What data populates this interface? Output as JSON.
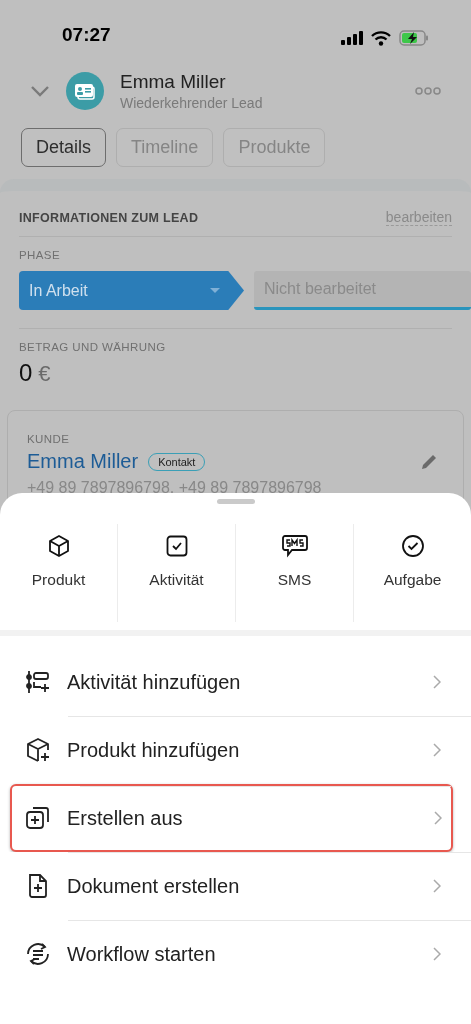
{
  "status_bar": {
    "time": "07:27"
  },
  "header": {
    "title": "Emma Miller",
    "subtitle": "Wiederkehrender Lead"
  },
  "tabs": [
    {
      "label": "Details",
      "selected": true
    },
    {
      "label": "Timeline",
      "selected": false
    },
    {
      "label": "Produkte",
      "selected": false
    }
  ],
  "lead_info": {
    "title": "INFORMATIONEN ZUM LEAD",
    "edit_link": "bearbeiten",
    "phase_label": "PHASE",
    "stages": [
      {
        "label": "In Arbeit",
        "selected": true
      },
      {
        "label": "Nicht bearbeitet",
        "selected": false
      }
    ],
    "amount_label": "BETRAG UND WÄHRUNG",
    "amount": "0",
    "currency": "€"
  },
  "customer": {
    "label": "KUNDE",
    "name": "Emma Miller",
    "badge": "Kontakt",
    "phones": "+49 89 7897896798, +49 89 7897896798"
  },
  "sheet": {
    "quick_actions": [
      {
        "kind": "product",
        "label": "Produkt"
      },
      {
        "kind": "activity",
        "label": "Aktivität"
      },
      {
        "kind": "sms",
        "label": "SMS"
      },
      {
        "kind": "task",
        "label": "Aufgabe"
      }
    ],
    "menu": [
      {
        "kind": "activity",
        "label": "Aktivität hinzufügen",
        "highlighted": false
      },
      {
        "kind": "product",
        "label": "Produkt hinzufügen",
        "highlighted": false
      },
      {
        "kind": "create",
        "label": "Erstellen aus",
        "highlighted": true
      },
      {
        "kind": "document",
        "label": "Dokument erstellen",
        "highlighted": false
      },
      {
        "kind": "workflow",
        "label": "Workflow starten",
        "highlighted": false
      }
    ]
  }
}
